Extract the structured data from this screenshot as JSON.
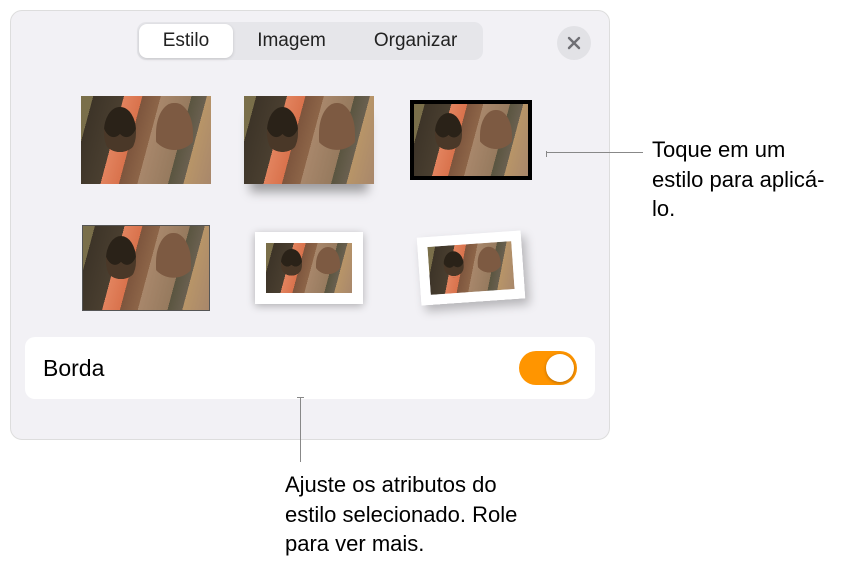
{
  "tabs": {
    "style": "Estilo",
    "image": "Imagem",
    "organize": "Organizar"
  },
  "styles": [
    {
      "name": "style-plain"
    },
    {
      "name": "style-shadow"
    },
    {
      "name": "style-black-frame"
    },
    {
      "name": "style-thin-border"
    },
    {
      "name": "style-white-mat"
    },
    {
      "name": "style-polaroid-tilt"
    }
  ],
  "section": {
    "border_label": "Borda",
    "border_on": true
  },
  "callouts": {
    "apply_style": "Toque em um estilo para aplicá-lo.",
    "adjust_attributes": "Ajuste os atributos do estilo selecionado. Role para ver mais."
  },
  "colors": {
    "accent": "#ff9500"
  }
}
